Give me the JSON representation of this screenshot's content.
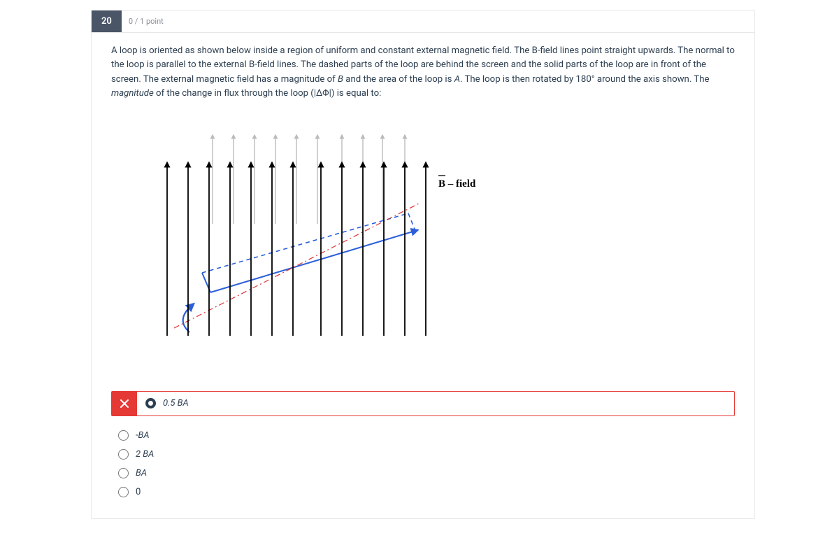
{
  "question": {
    "number": "20",
    "points_label": "0 / 1 point",
    "text_before": "A loop is oriented as shown below inside a region of uniform and constant external magnetic field. The B-field lines point straight upwards. The normal to the loop is parallel to the external B-field lines. The dashed parts of the loop are behind the screen and the solid parts of the loop are in front of the screen. The external magnetic field has a magnitude of ",
    "text_i1": "B",
    "text_mid1": " and the area of the loop is ",
    "text_i2": "A",
    "text_mid2": ". The loop is then rotated by 180° around the axis shown. The ",
    "text_em": "magnitude",
    "text_after": " of the change in flux through the loop (|ΔΦ|) is equal to:"
  },
  "diagram": {
    "b_field_label": "B – field"
  },
  "answers": {
    "selected_wrong": "0.5 BA",
    "options": [
      {
        "label": "-BA",
        "italic": true
      },
      {
        "label": "2 BA",
        "italic": true
      },
      {
        "label": "BA",
        "italic": true
      },
      {
        "label": "0",
        "italic": false
      }
    ]
  }
}
